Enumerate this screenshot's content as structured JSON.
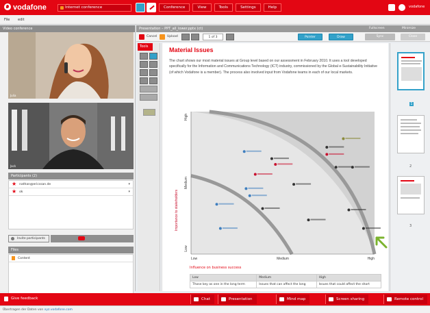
{
  "topbar": {
    "brand": "vodafone",
    "conference_title": "Internet conference",
    "menu": [
      "Conference",
      "View",
      "Tools",
      "Settings",
      "Help"
    ],
    "right_text": "vodafone"
  },
  "subbar": {
    "file": "File",
    "edit": "edit"
  },
  "left": {
    "video_header": "Video conference",
    "video1_label": "Julia",
    "video2_label": "Jack",
    "participants_header": "Participants (2)",
    "participants": [
      "nathan@ericssan.de",
      "ok"
    ],
    "invite_label": "Invite participants",
    "files_header": "Files",
    "files": [
      "Content"
    ]
  },
  "presentation": {
    "header_title": "Presentation – PPT_all_lower.pptx (ct)",
    "ext1": "Fullscreen",
    "ext2": "Minimize",
    "toolbar": {
      "cancel": "Cancel",
      "upload": "Upload",
      "page": "1 of 3",
      "pointer": "Pointer",
      "draw": "Draw",
      "sync": "Sync",
      "last": "Close"
    },
    "tools_label": "Tools"
  },
  "slide": {
    "title": "Material Issues",
    "body": "The chart shows our most material issues at Group level based on our assessment in February 2010. It uses a tool developed specifically for the Information and Communications Technology (ICT) industry, commissioned by the Global e-Sustainability Initiative (of which Vodafone is a member). The process also involved input from Vodafone teams in each of our local markets.",
    "table_title": "Influence on business success",
    "table_head": [
      "Low",
      "Medium",
      "High"
    ],
    "table_row": [
      "Those key as one in the long term",
      "Issues that can affect the long",
      "Issues that could affect the short"
    ]
  },
  "chart_data": {
    "type": "scatter",
    "xlabel": "Influence on business success",
    "ylabel": "Importance to stakeholders",
    "x_ticks": [
      "Low",
      "Medium",
      "High"
    ],
    "y_ticks": [
      "Low",
      "Medium",
      "High"
    ],
    "xlim": [
      0,
      10
    ],
    "ylim": [
      0,
      10
    ],
    "points": [
      {
        "x": 8.3,
        "y": 8.1,
        "series": "olive"
      },
      {
        "x": 7.4,
        "y": 7.5,
        "series": "dark"
      },
      {
        "x": 7.4,
        "y": 7.0,
        "series": "red"
      },
      {
        "x": 7.9,
        "y": 6.1,
        "series": "dark"
      },
      {
        "x": 8.8,
        "y": 6.1,
        "series": "dark"
      },
      {
        "x": 2.9,
        "y": 7.2,
        "series": "blue"
      },
      {
        "x": 4.4,
        "y": 6.7,
        "series": "dark"
      },
      {
        "x": 4.6,
        "y": 6.3,
        "series": "red"
      },
      {
        "x": 3.5,
        "y": 5.6,
        "series": "red"
      },
      {
        "x": 5.6,
        "y": 4.9,
        "series": "dark"
      },
      {
        "x": 3.0,
        "y": 4.6,
        "series": "blue"
      },
      {
        "x": 3.2,
        "y": 4.1,
        "series": "blue"
      },
      {
        "x": 1.4,
        "y": 3.5,
        "series": "blue"
      },
      {
        "x": 3.9,
        "y": 3.2,
        "series": "dark"
      },
      {
        "x": 8.6,
        "y": 3.1,
        "series": "dark"
      },
      {
        "x": 6.4,
        "y": 2.4,
        "series": "dark"
      },
      {
        "x": 1.6,
        "y": 1.8,
        "series": "blue"
      },
      {
        "x": 9.4,
        "y": 1.8,
        "series": "dark"
      }
    ],
    "colors": {
      "red": "#c8102e",
      "blue": "#3f7fbf",
      "dark": "#333333",
      "olive": "#8a8a3a"
    }
  },
  "thumbs": [
    "1",
    "2",
    "3"
  ],
  "bottombar": {
    "feedback": "Give feedback",
    "buttons": [
      "Chat",
      "Presentation",
      "Mind map",
      "Screen sharing",
      "Remote control"
    ]
  },
  "status": {
    "text": "Übertragen der Daten von",
    "link": "xyz.vodafone.com"
  }
}
